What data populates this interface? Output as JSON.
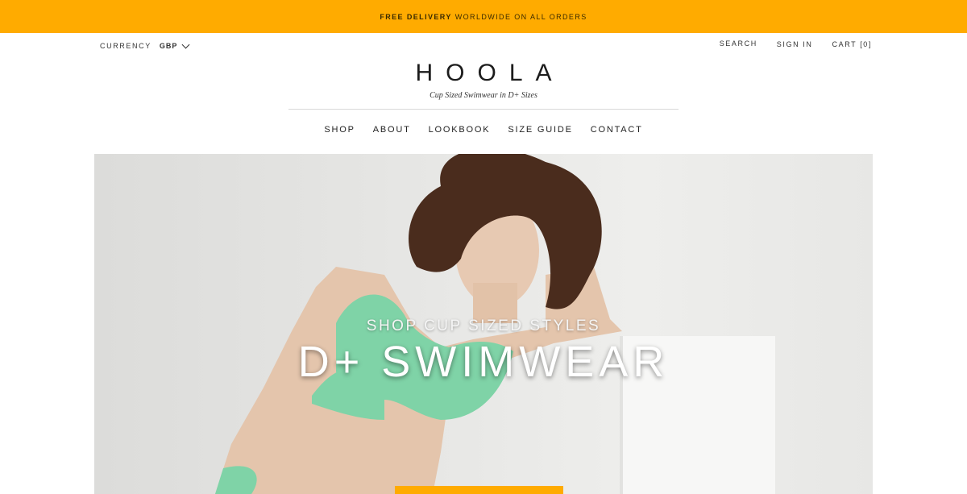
{
  "promo": {
    "bold": "FREE DELIVERY",
    "rest": "WORLDWIDE ON ALL ORDERS"
  },
  "currency": {
    "label": "CURRENCY",
    "value": "GBP"
  },
  "utility": {
    "search": "SEARCH",
    "sign_in": "SIGN IN",
    "cart": "CART [0]"
  },
  "brand": {
    "logo": "HOOLA",
    "tagline": "Cup Sized Swimwear in D+ Sizes"
  },
  "nav": {
    "items": [
      "SHOP",
      "ABOUT",
      "LOOKBOOK",
      "SIZE GUIDE",
      "CONTACT"
    ]
  },
  "hero": {
    "subtitle": "SHOP CUP SIZED STYLES",
    "title": "D+ SWIMWEAR"
  },
  "colors": {
    "accent": "#ffab00",
    "swimwear": "#7fd3a7"
  }
}
